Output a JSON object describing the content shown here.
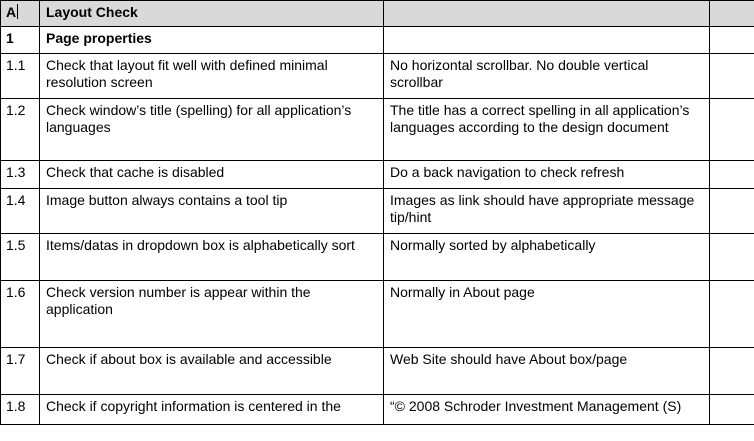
{
  "header": {
    "col_a": "A",
    "col_b": "Layout Check",
    "col_c": "",
    "col_d": ""
  },
  "section": {
    "id": "1",
    "title": "Page properties"
  },
  "rows": [
    {
      "id": "1.1",
      "check": "Check that layout fit well with defined minimal resolution screen",
      "expected": "No horizontal scrollbar. No double vertical scrollbar"
    },
    {
      "id": "1.2",
      "check": "Check window’s title (spelling) for all application’s languages",
      "expected": "The title has a correct spelling in all application’s languages according to the design document"
    },
    {
      "id": "1.3",
      "check": "Check that cache is disabled",
      "expected": "Do a back navigation to check refresh"
    },
    {
      "id": "1.4",
      "check": "Image button always contains a tool tip",
      "expected": "Images as link should have appropriate message tip/hint"
    },
    {
      "id": "1.5",
      "check": "Items/datas in dropdown box is alphabetically sort",
      "expected": "Normally sorted by alphabetically"
    },
    {
      "id": "1.6",
      "check": "Check version number is appear within the application",
      "expected": "Normally in About page"
    },
    {
      "id": "1.7",
      "check": "Check if about box is available and accessible",
      "expected": "Web Site should have About box/page"
    },
    {
      "id": "1.8",
      "check": "Check if copyright information is centered in the",
      "expected": "“© 2008 Schroder Investment Management (S)"
    }
  ]
}
